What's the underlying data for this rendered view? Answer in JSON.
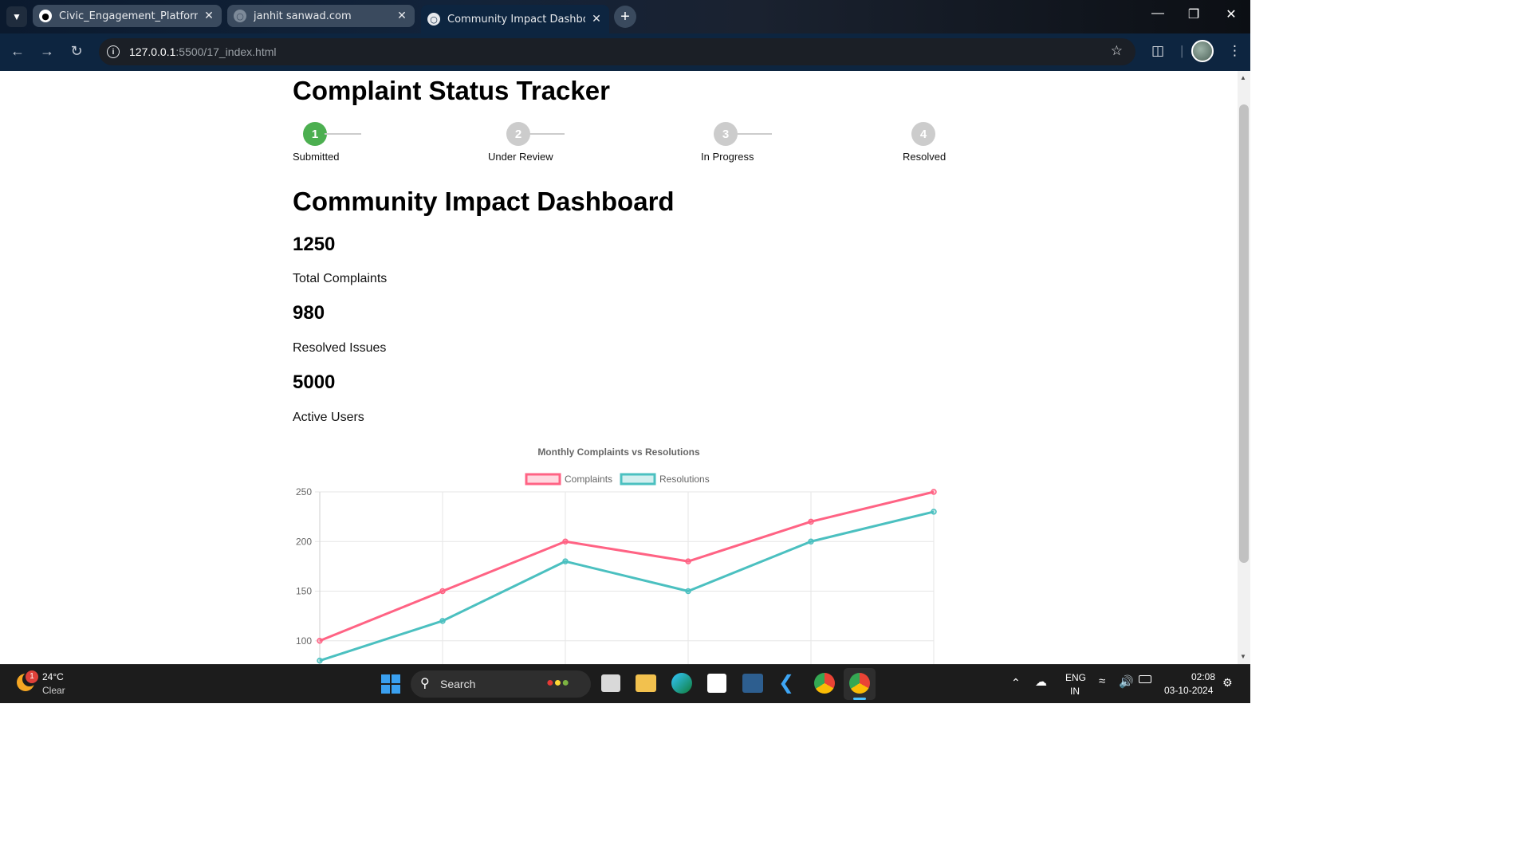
{
  "browser": {
    "tabs": [
      {
        "label": "Civic_Engagement_Platform/Sc",
        "icon": "github-icon",
        "active": false
      },
      {
        "label": "janhit sanwad.com",
        "icon": "globe-icon",
        "active": false
      },
      {
        "label": "Community Impact Dashboard",
        "icon": "globe-icon",
        "active": true
      }
    ],
    "url_host": "127.0.0.1",
    "url_path": ":5500/17_index.html"
  },
  "tracker": {
    "title": "Complaint Status Tracker",
    "steps": [
      {
        "number": "1",
        "label": "Submitted",
        "status": "active",
        "color": "#4caf50"
      },
      {
        "number": "2",
        "label": "Under Review",
        "status": "pending",
        "color": "#cccccc"
      },
      {
        "number": "3",
        "label": "In Progress",
        "status": "pending",
        "color": "#cccccc"
      },
      {
        "number": "4",
        "label": "Resolved",
        "status": "pending",
        "color": "#cccccc"
      }
    ]
  },
  "dashboard": {
    "title": "Community Impact Dashboard",
    "stats": [
      {
        "value": "1250",
        "label": "Total Complaints"
      },
      {
        "value": "980",
        "label": "Resolved Issues"
      },
      {
        "value": "5000",
        "label": "Active Users"
      }
    ]
  },
  "chart_data": {
    "type": "line",
    "title": "Monthly Complaints vs Resolutions",
    "legend_position": "top",
    "grid": true,
    "ylim_visible": [
      80,
      250
    ],
    "y_ticks": [
      250,
      200,
      150,
      100
    ],
    "x_points": 6,
    "series": [
      {
        "name": "Complaints",
        "color": "#ff6384",
        "values": [
          100,
          150,
          200,
          180,
          220,
          250
        ]
      },
      {
        "name": "Resolutions",
        "color": "#4bc0c0",
        "values": [
          80,
          120,
          180,
          150,
          200,
          230
        ]
      }
    ]
  },
  "taskbar": {
    "weather_temp": "24°C",
    "weather_desc": "Clear",
    "weather_badge": "1",
    "search_label": "Search",
    "lang_top": "ENG",
    "lang_bottom": "IN",
    "time": "02:08",
    "date": "03-10-2024"
  }
}
